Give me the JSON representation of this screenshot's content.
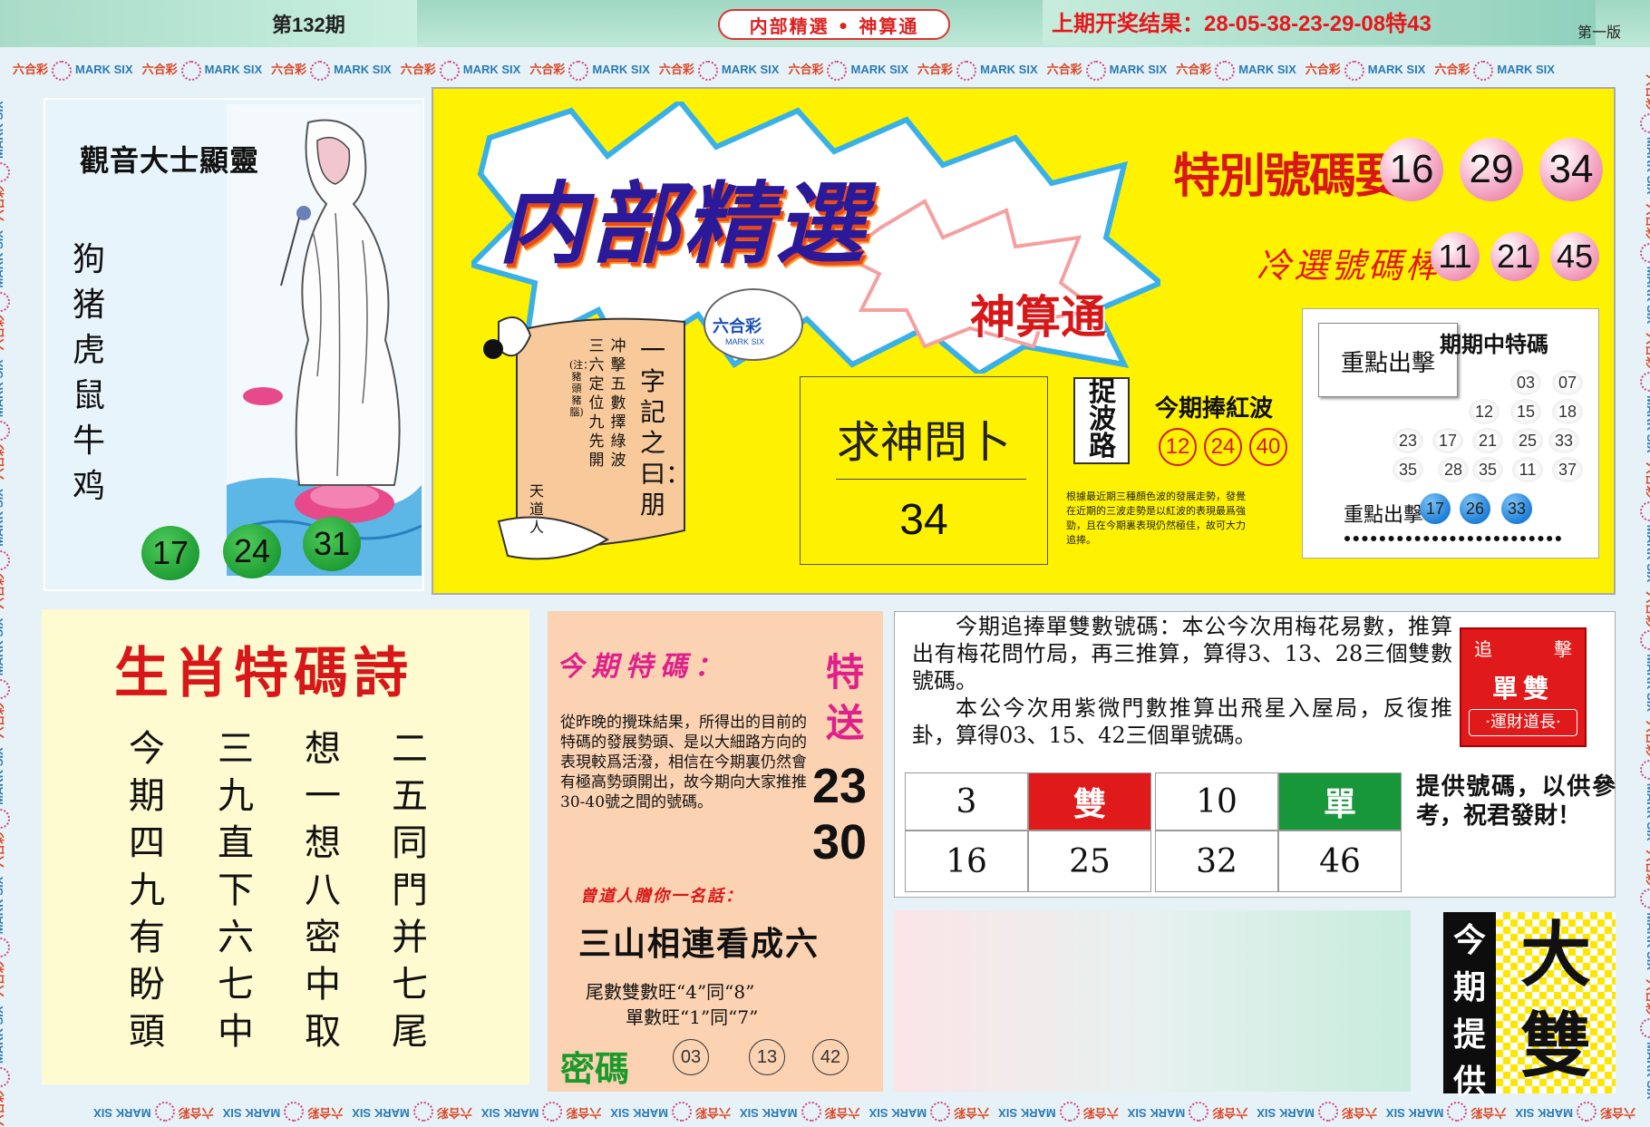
{
  "header": {
    "issue": "第132期",
    "pill": "内部精選 • 神算通",
    "last_result": "上期开奖结果：28-05-38-23-29-08特43",
    "page_label": "第一版"
  },
  "brand": {
    "cn": "六合彩",
    "en": "MARK SIX"
  },
  "guanyin": {
    "title": "觀音大士顯靈",
    "zodiac": "狗猪虎鼠牛鸡",
    "numbers": [
      "17",
      "24",
      "31"
    ]
  },
  "main": {
    "title": "内部精選",
    "subtitle": "神算通",
    "logo_cn": "六合彩",
    "logo_en": "MARK SIX",
    "special_label": "特別號碼要",
    "special_numbers": [
      "16",
      "29",
      "34"
    ],
    "cold_label": "冷選號碼棒",
    "cold_numbers": [
      "11",
      "21",
      "45"
    ],
    "scroll": {
      "title": "一字記之曰：朋",
      "lines": [
        "冲擊五數擇綠波",
        "三六定位九先開"
      ],
      "note": "(注：豬頭豬腦)",
      "sign": "天道人"
    },
    "divine": {
      "title": "求神問卜",
      "number": "34"
    },
    "wave": {
      "box": "捉波路",
      "label": "今期捧紅波",
      "numbers": [
        "12",
        "24",
        "40"
      ],
      "note": "根據最近期三種顏色波的發展走勢，發覺在近期的三波走勢是以紅波的表現最爲強勁，且在今期裏表現仍然極佳，故可大力追捧。"
    },
    "grid": {
      "focus": "重點出擊",
      "title": "期期中特碼",
      "rows": [
        [
          "03",
          "07"
        ],
        [
          "12",
          "15",
          "18"
        ],
        [
          "23",
          "17",
          "21",
          "25",
          "33"
        ],
        [
          "35",
          "28",
          "35",
          "11",
          "37"
        ]
      ],
      "strike_label": "重點出擊",
      "strike_numbers": [
        "17",
        "26",
        "33"
      ]
    }
  },
  "poem": {
    "title": "生肖特碼詩",
    "columns": [
      "今期四九有盼頭",
      "三九直下六七中",
      "想一想八密中取",
      "二五同門并七尾"
    ]
  },
  "special": {
    "title": "今期特碼：",
    "side": "特送",
    "body": "從昨晚的攪珠結果，所得出的目前的特碼的發展勢頭、是以大細路方向的表現較爲活潑，相信在今期裏仍然會有極高勢頭開出，故今期向大家推推30-40號之間的號碼。",
    "numbers": [
      "23",
      "30"
    ],
    "gift": "曾道人贈你一名話：",
    "phrase": "三山相連看成六",
    "tail1": "尾數雙數旺“4”同“8”",
    "tail2": "單數旺“1”同“7”",
    "secret_label": "密碼",
    "secret_numbers": [
      "03",
      "13",
      "42"
    ]
  },
  "odd_even": {
    "para1": "今期追捧單雙數號碼：本公今次用梅花易數，推算出有梅花問竹局，再三推算，算得3、13、28三個雙數號碼。",
    "para2": "本公今次用紫微門數推算出飛星入屋局，反復推卦，算得03、15、42三個單號碼。",
    "badge_l": "追",
    "badge_r": "擊",
    "badge_main": "單雙",
    "badge_sub": "·運財道長·",
    "even_label": "雙",
    "odd_label": "單",
    "even_cells": [
      "3",
      "16",
      "25"
    ],
    "odd_cells": [
      "10",
      "32",
      "46"
    ],
    "note": "提供號碼，以供參考，祝君發財！"
  },
  "bottom": {
    "vertical": "今期提供",
    "big": "大雙"
  },
  "colors": {
    "red": "#e01a1a",
    "green": "#1a9a3a",
    "yellow": "#fff200"
  }
}
